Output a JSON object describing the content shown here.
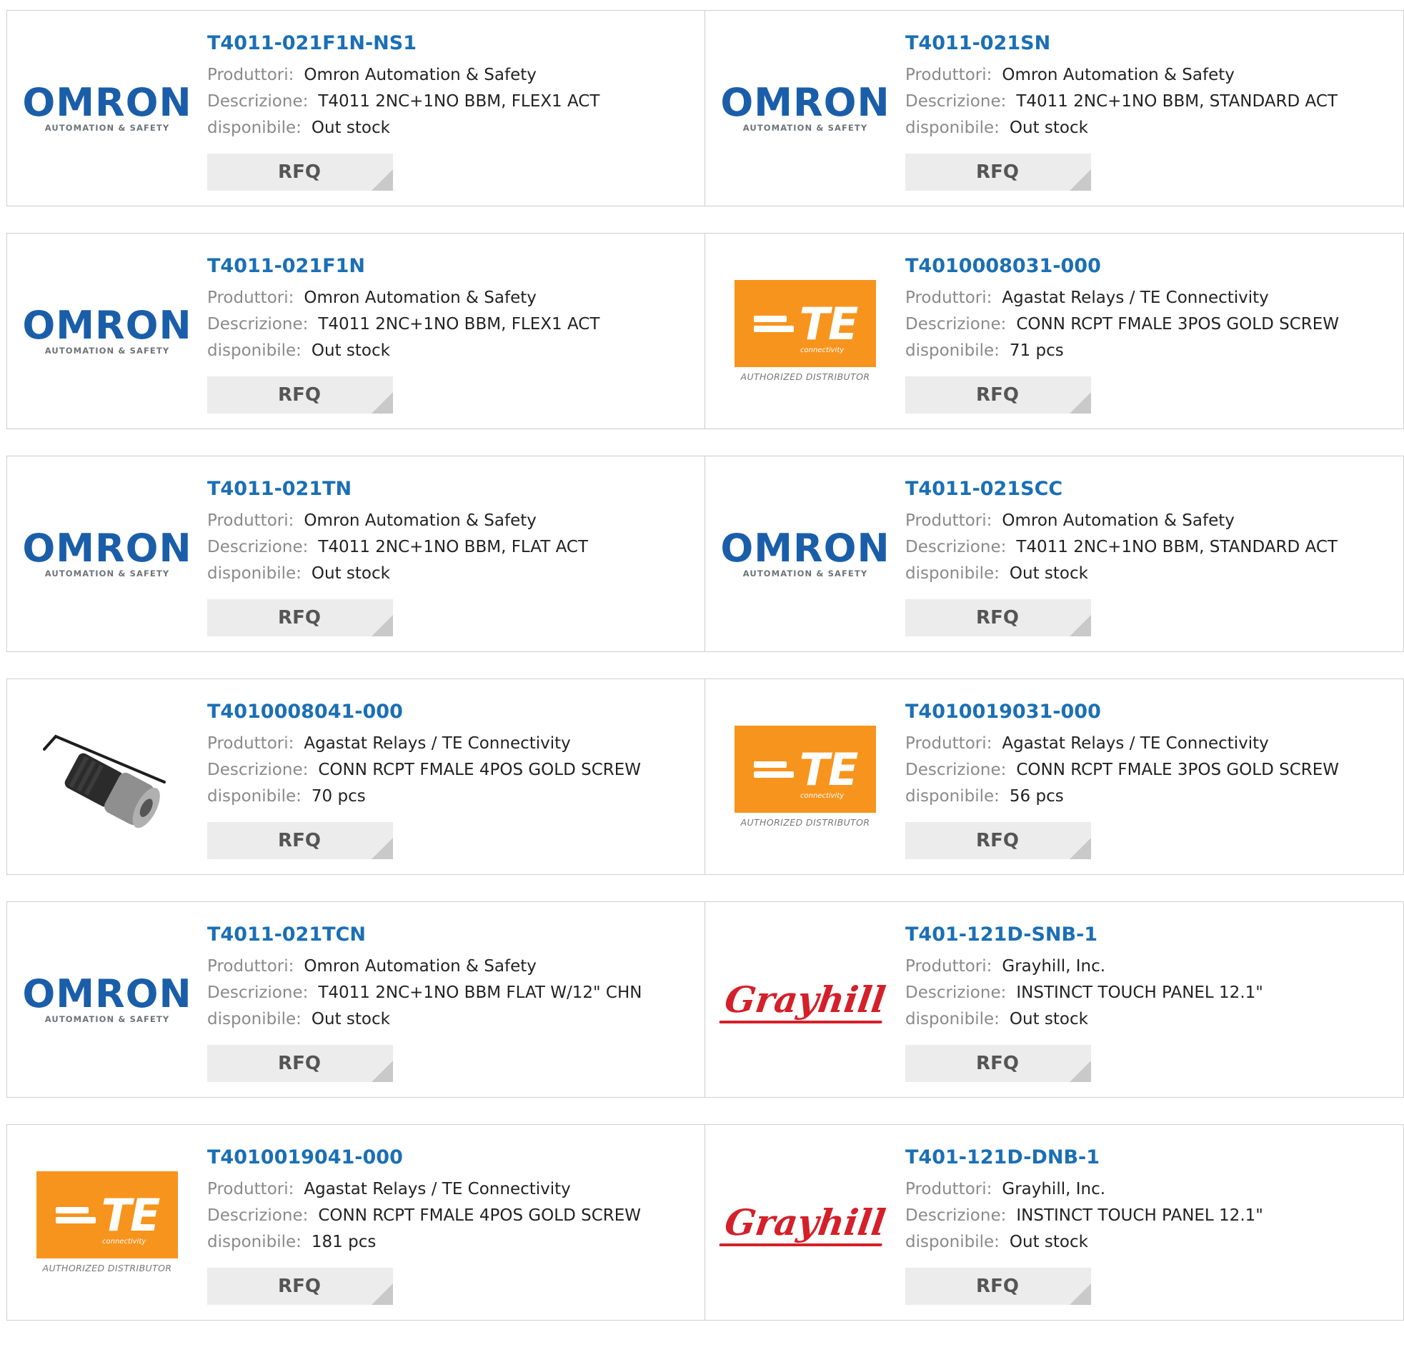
{
  "labels": {
    "producers": "Produttori:",
    "description": "Descrizione:",
    "availability": "disponibile:",
    "rfq": "RFQ"
  },
  "logos": {
    "omron_word": "OMRON",
    "omron_sub": "AUTOMATION & SAFETY",
    "te_word": "TE",
    "te_connectivity": "connectivity",
    "te_authorized": "AUTHORIZED DISTRIBUTOR",
    "grayhill_word": "Grayhill"
  },
  "products": [
    {
      "part": "T4011-021F1N-NS1",
      "producer": "Omron Automation & Safety",
      "description": "T4011 2NC+1NO BBM, FLEX1 ACT",
      "availability": "Out stock",
      "logo": "omron"
    },
    {
      "part": "T4011-021SN",
      "producer": "Omron Automation & Safety",
      "description": "T4011 2NC+1NO BBM, STANDARD ACT",
      "availability": "Out stock",
      "logo": "omron"
    },
    {
      "part": "T4011-021F1N",
      "producer": "Omron Automation & Safety",
      "description": "T4011 2NC+1NO BBM, FLEX1 ACT",
      "availability": "Out stock",
      "logo": "omron"
    },
    {
      "part": "T4010008031-000",
      "producer": "Agastat Relays / TE Connectivity",
      "description": "CONN RCPT FMALE 3POS GOLD SCREW",
      "availability": "71 pcs",
      "logo": "te"
    },
    {
      "part": "T4011-021TN",
      "producer": "Omron Automation & Safety",
      "description": "T4011 2NC+1NO BBM, FLAT ACT",
      "availability": "Out stock",
      "logo": "omron"
    },
    {
      "part": "T4011-021SCC",
      "producer": "Omron Automation & Safety",
      "description": "T4011 2NC+1NO BBM, STANDARD ACT",
      "availability": "Out stock",
      "logo": "omron"
    },
    {
      "part": "T4010008041-000",
      "producer": "Agastat Relays / TE Connectivity",
      "description": "CONN RCPT FMALE 4POS GOLD SCREW",
      "availability": "70 pcs",
      "logo": "connector-photo"
    },
    {
      "part": "T4010019031-000",
      "producer": "Agastat Relays / TE Connectivity",
      "description": "CONN RCPT FMALE 3POS GOLD SCREW",
      "availability": "56 pcs",
      "logo": "te"
    },
    {
      "part": "T4011-021TCN",
      "producer": "Omron Automation & Safety",
      "description": "T4011 2NC+1NO BBM FLAT W/12\" CHN",
      "availability": "Out stock",
      "logo": "omron"
    },
    {
      "part": "T401-121D-SNB-1",
      "producer": "Grayhill, Inc.",
      "description": "INSTINCT TOUCH PANEL 12.1\"",
      "availability": "Out stock",
      "logo": "grayhill"
    },
    {
      "part": "T4010019041-000",
      "producer": "Agastat Relays / TE Connectivity",
      "description": "CONN RCPT FMALE 4POS GOLD SCREW",
      "availability": "181 pcs",
      "logo": "te"
    },
    {
      "part": "T401-121D-DNB-1",
      "producer": "Grayhill, Inc.",
      "description": "INSTINCT TOUCH PANEL 12.1\"",
      "availability": "Out stock",
      "logo": "grayhill"
    }
  ]
}
